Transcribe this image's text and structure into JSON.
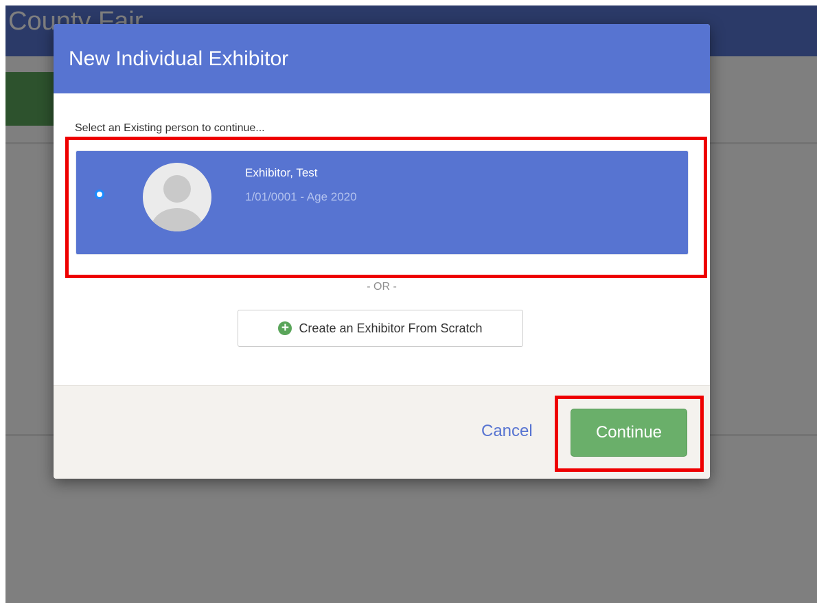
{
  "app": {
    "title": "County Fair"
  },
  "modal": {
    "title": "New Individual Exhibitor",
    "instruction": "Select an Existing person to continue...",
    "person": {
      "name": "Exhibitor, Test",
      "details": "1/01/0001 - Age 2020",
      "selected": true
    },
    "or_label": "- OR -",
    "create_button_label": "Create an Exhibitor From Scratch",
    "create_button_icon": "plus-circle-icon",
    "footer": {
      "cancel_label": "Cancel",
      "continue_label": "Continue"
    }
  },
  "colors": {
    "primary": "#5774d1",
    "success": "#6aaf6a",
    "highlight": "#ee0000",
    "radio": "#1a8cff"
  }
}
